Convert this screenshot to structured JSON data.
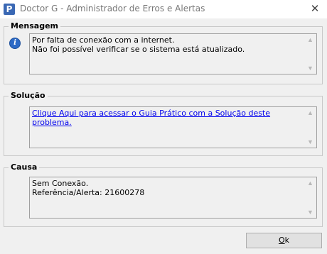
{
  "window": {
    "title": "Doctor G - Administrador de Erros e Alertas",
    "app_icon_glyph": "P",
    "close_glyph": "✕"
  },
  "mensagem": {
    "label": "Mensagem",
    "icon": "info-icon",
    "lines": [
      "Por falta de conexão com a internet.",
      "Não foi possível verificar se o sistema está atualizado."
    ]
  },
  "solucao": {
    "label": "Solução",
    "link_text": "Clique Aqui para acessar o Guia Prático com a Solução deste problema."
  },
  "causa": {
    "label": "Causa",
    "lines": [
      "Sem Conexão.",
      "Referência/Alerta: 21600278"
    ]
  },
  "buttons": {
    "ok_label": "Ok"
  },
  "colors": {
    "link": "#0000ee",
    "info_icon": "#2d6ac6",
    "app_icon": "#3a68b4"
  }
}
